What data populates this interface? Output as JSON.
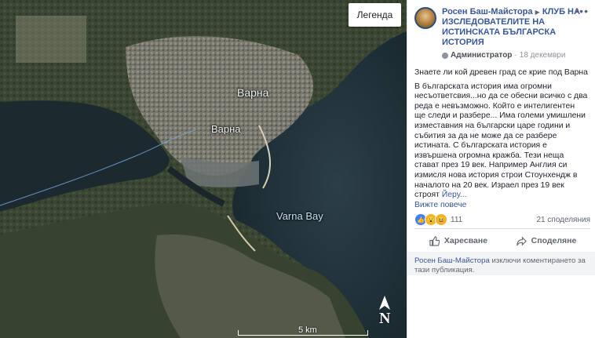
{
  "map": {
    "legend_label": "Легенда",
    "labels": {
      "city_1": "Варна",
      "city_2": "Варна",
      "bay": "Varna Bay"
    },
    "north_label": "N",
    "scale_label": "5 km",
    "colors": {
      "water": "#1e2d35",
      "land": "#3f4a38",
      "urban": "#8a8a80",
      "lake_boundary": "#7aa8e0"
    }
  },
  "post": {
    "author": "Росен Баш-Майстора",
    "arrow_icon": "▶",
    "group": "КЛУБ НА ИЗСЛЕДОВАТЕЛИТЕ НА ИСТИНСКАТА БЪЛГАРСКА ИСТОРИЯ",
    "role": "Администратор",
    "separator": "·",
    "date": "18 декември",
    "more_icon": "•••",
    "headline": "Знаете ли кой древен град се крие под Варна",
    "body": "В българската история има огромни несъответсвия...но да се обесни всичко с два реда е невъзможно. Който е интелигентен ще следи и разбере... Има големи умишлени изместавния на български царе години и събития за да не може да се разбере истината. С българската история е извършена огромна кражба. Тези неща стават през 19 век. Например Англия си измисля нова история строи Стоунхендж в началото на 20 век. Израел през 19 век строят",
    "truncated": "Йеру...",
    "see_more": "Вижте повече",
    "reaction_count": "111",
    "shares": "21 споделяния",
    "like_label": "Харесване",
    "share_label": "Споделяне",
    "comments_off_author": "Росен Баш-Майстора",
    "comments_off_text": " изключи коментирането за тази публикация."
  }
}
